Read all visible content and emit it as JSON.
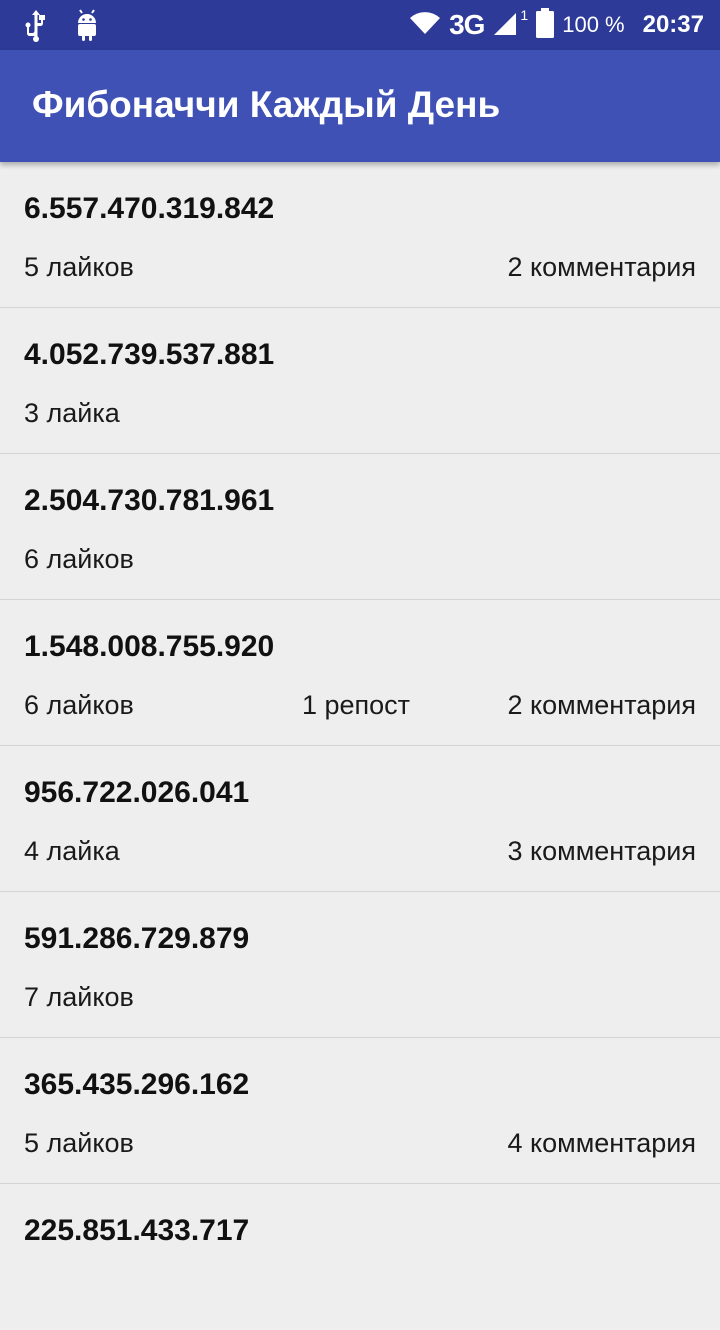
{
  "status_bar": {
    "icons_left": [
      "usb-icon",
      "android-debug-icon"
    ],
    "network": "3G",
    "sim": "1",
    "battery": "100 %",
    "time": "20:37"
  },
  "app_bar": {
    "title": "Фибоначчи Каждый День"
  },
  "colors": {
    "status_bar": "#2d3a98",
    "app_bar": "#3f51b5",
    "background": "#eeeeee"
  },
  "posts": [
    {
      "value": "6.557.470.319.842",
      "likes": "5 лайков",
      "reposts": "",
      "comments": "2 комментария"
    },
    {
      "value": "4.052.739.537.881",
      "likes": "3 лайка",
      "reposts": "",
      "comments": ""
    },
    {
      "value": "2.504.730.781.961",
      "likes": "6 лайков",
      "reposts": "",
      "comments": ""
    },
    {
      "value": "1.548.008.755.920",
      "likes": "6 лайков",
      "reposts": "1 репост",
      "comments": "2 комментария"
    },
    {
      "value": "956.722.026.041",
      "likes": "4 лайка",
      "reposts": "",
      "comments": "3 комментария"
    },
    {
      "value": "591.286.729.879",
      "likes": "7 лайков",
      "reposts": "",
      "comments": ""
    },
    {
      "value": "365.435.296.162",
      "likes": "5 лайков",
      "reposts": "",
      "comments": "4 комментария"
    },
    {
      "value": "225.851.433.717",
      "likes": "",
      "reposts": "",
      "comments": ""
    }
  ]
}
